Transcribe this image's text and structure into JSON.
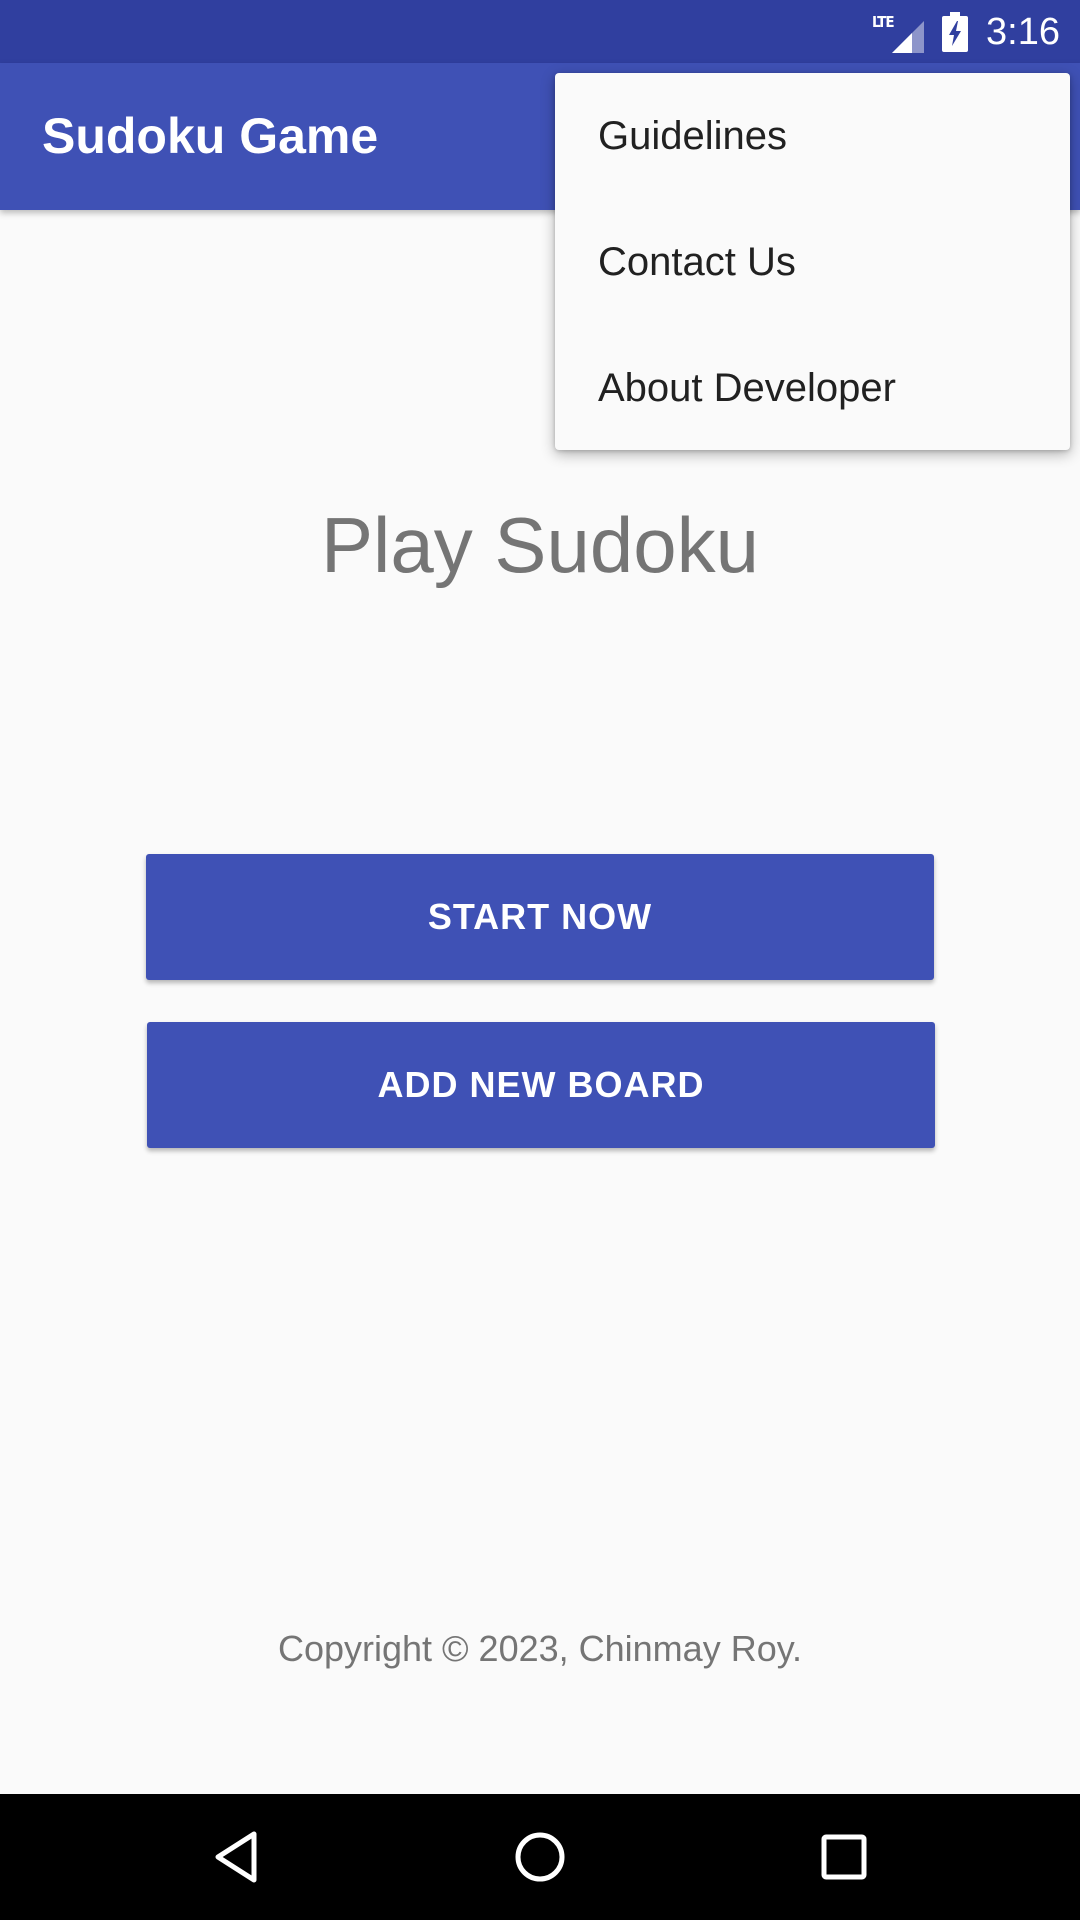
{
  "status_bar": {
    "network": "LTE",
    "time": "3:16",
    "background": "#303F9F"
  },
  "app_bar": {
    "title": "Sudoku Game",
    "background": "#3F51B5"
  },
  "overflow_menu": {
    "items": [
      {
        "label": "Guidelines"
      },
      {
        "label": "Contact Us"
      },
      {
        "label": "About Developer"
      }
    ]
  },
  "main": {
    "title": "Play Sudoku",
    "start_label": "START NOW",
    "add_board_label": "ADD NEW BOARD",
    "copyright": "Copyright © 2023, Chinmay Roy."
  },
  "nav_bar": {
    "back_icon": "back-triangle",
    "home_icon": "home-circle",
    "recents_icon": "recents-square"
  },
  "colors": {
    "primary": "#3F51B5",
    "primary_dark": "#303F9F",
    "text_secondary": "#757575",
    "background": "#FAFAFA"
  }
}
